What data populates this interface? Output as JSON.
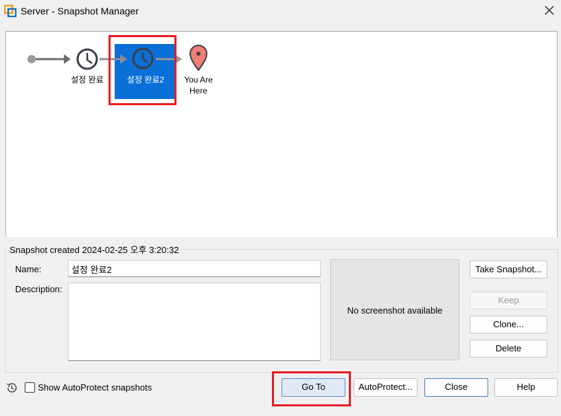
{
  "window": {
    "title": "Server - Snapshot Manager"
  },
  "tree": {
    "nodes": [
      {
        "label": "설정 완료"
      },
      {
        "label": "설정 완료2",
        "selected": true
      },
      {
        "label_line1": "You Are",
        "label_line2": "Here"
      }
    ],
    "colors": {
      "selected_bg": "#0a6fd6",
      "highlight": "#e81b23",
      "pin": "#ef7f73"
    }
  },
  "details": {
    "group_title": "Snapshot created 2024-02-25 오후 3:20:32",
    "name_label": "Name:",
    "name_value": "설정 완료2",
    "description_label": "Description:",
    "description_value": "",
    "preview_text": "No screenshot available"
  },
  "side_buttons": {
    "take_snapshot": "Take Snapshot...",
    "keep": "Keep",
    "clone": "Clone...",
    "delete": "Delete"
  },
  "footer": {
    "show_autoprotect_label": "Show AutoProtect snapshots",
    "show_autoprotect_checked": false,
    "goto": "Go To",
    "autoprotect": "AutoProtect...",
    "close": "Close",
    "help": "Help"
  }
}
